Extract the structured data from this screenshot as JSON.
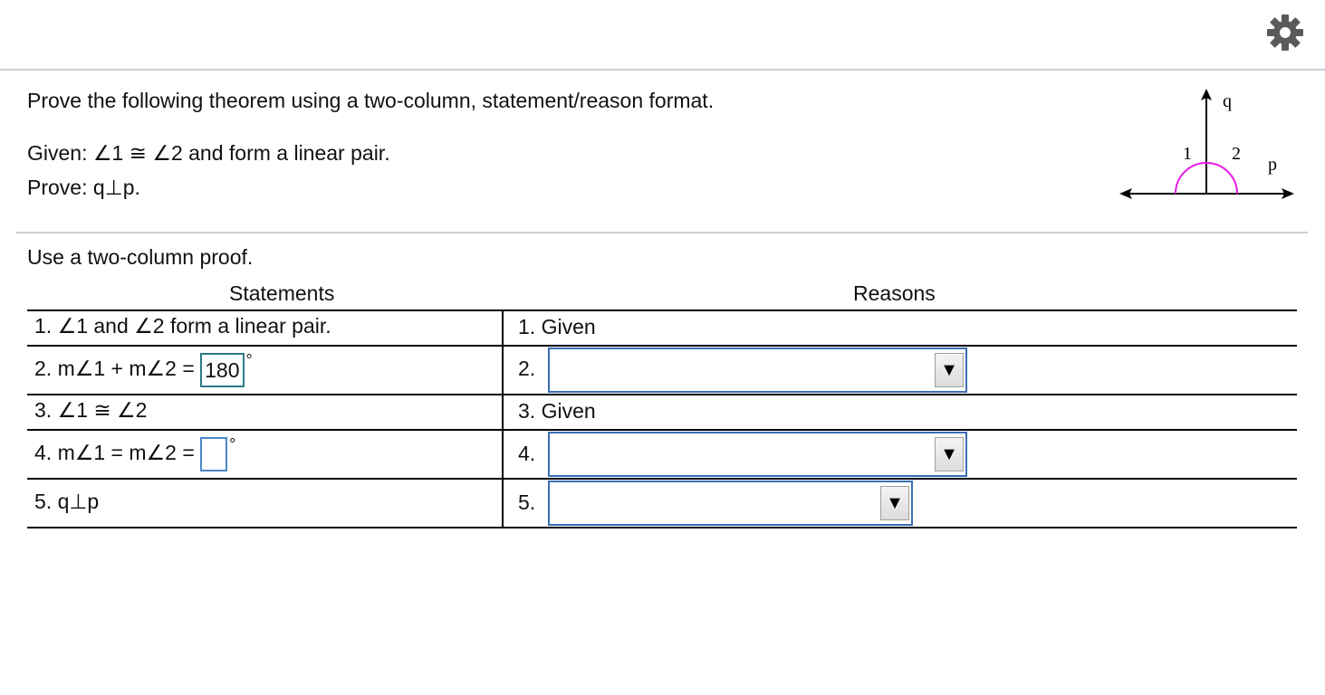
{
  "header": {
    "settings_icon": "gear-icon"
  },
  "problem": {
    "intro": "Prove the following theorem using a two-column, statement/reason format.",
    "given": "Given: ∠1 ≅ ∠2 and form a linear pair.",
    "prove": "Prove: q⊥p."
  },
  "figure": {
    "line_q": "q",
    "line_p": "p",
    "angle1": "1",
    "angle2": "2",
    "arc_color": "#e619e6"
  },
  "proof": {
    "instruction": "Use a two-column proof.",
    "headers": {
      "statements": "Statements",
      "reasons": "Reasons"
    },
    "rows": [
      {
        "statement": "1.   ∠1 and ∠2 form a linear pair.",
        "reason": "1. Given"
      },
      {
        "statement_prefix": "2.   m∠1 + m∠2 =",
        "statement_input": "180",
        "degree": "°",
        "reason_label": "2.",
        "reason_value": ""
      },
      {
        "statement": "3.  ∠1 ≅ ∠2",
        "reason": "3. Given"
      },
      {
        "statement_prefix": "4.  m∠1 = m∠2 =",
        "statement_input": "",
        "degree": "°",
        "reason_label": "4.",
        "reason_value": ""
      },
      {
        "statement": "5.   q⊥p",
        "reason_label": "5.",
        "reason_value": ""
      }
    ],
    "dropdown_arrow": "▼"
  }
}
